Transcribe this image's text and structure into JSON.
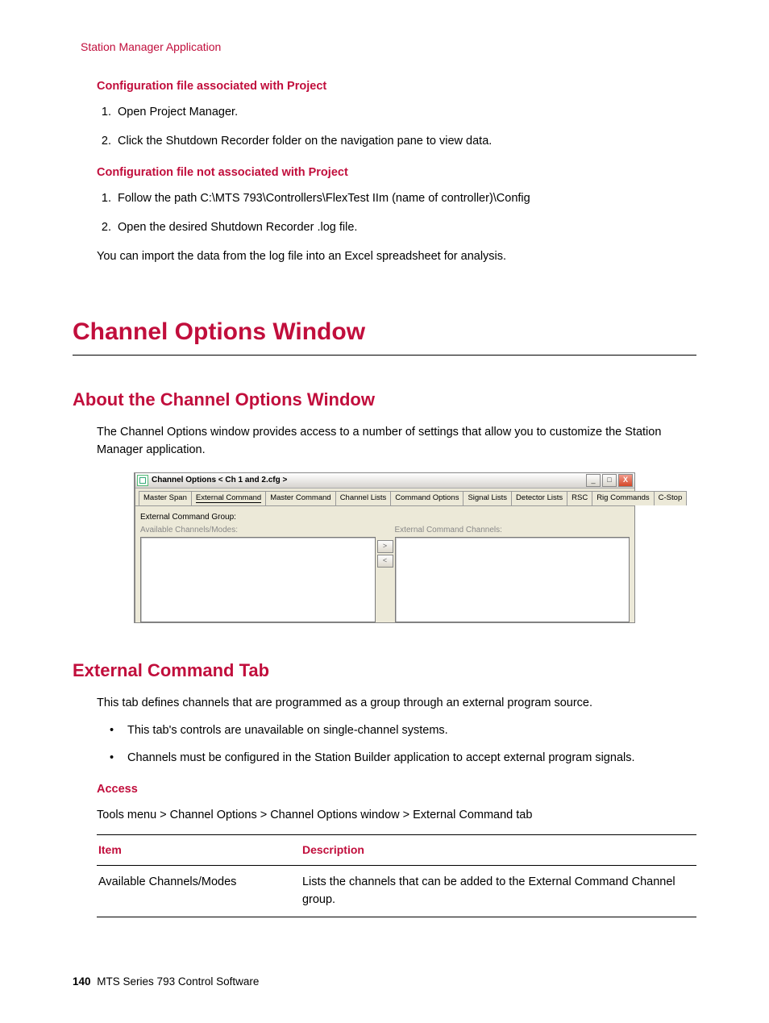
{
  "running_head": "Station Manager Application",
  "section_a": {
    "title": "Configuration file associated with Project",
    "steps": [
      "Open Project Manager.",
      "Click the Shutdown Recorder folder on the navigation pane to view data."
    ]
  },
  "section_b": {
    "title": "Configuration file not associated with Project",
    "steps": [
      "Follow the path C:\\MTS 793\\Controllers\\FlexTest IIm (name of controller)\\Config",
      "Open the desired Shutdown Recorder .log file."
    ]
  },
  "post_para": "You can import the data from the log file into an Excel spreadsheet for analysis.",
  "h1": "Channel Options Window",
  "h2_about": "About the Channel Options Window",
  "about_para": "The Channel Options window provides access to a number of settings that allow you to customize the Station Manager application.",
  "screenshot": {
    "title": "Channel Options < Ch 1 and 2.cfg >",
    "tabs": [
      "Master Span",
      "External Command",
      "Master Command",
      "Channel Lists",
      "Command Options",
      "Signal Lists",
      "Detector Lists",
      "RSC",
      "Rig Commands",
      "C-Stop"
    ],
    "active_tab_index": 1,
    "group_label": "External Command Group:",
    "left_label": "Available Channels/Modes:",
    "right_label": "External Command Channels:",
    "btn_min": "_",
    "btn_max": "□",
    "btn_close": "X",
    "arrow_r": ">",
    "arrow_l": "<"
  },
  "h2_ext": "External Command Tab",
  "ext_para": "This tab defines channels that are programmed as a group through an external program source.",
  "ext_bullets": [
    "This tab's controls are unavailable on single-channel systems.",
    "Channels must be configured in the Station Builder application to accept external program signals."
  ],
  "access_title": "Access",
  "access_path": "Tools menu > Channel Options > Channel Options window > External Command tab",
  "table": {
    "h1": "Item",
    "h2": "Description",
    "rows": [
      {
        "item": "Available Channels/Modes",
        "desc": "Lists the channels that can be added to the External Command Channel group."
      }
    ]
  },
  "footer": {
    "page": "140",
    "text": "MTS Series 793 Control Software"
  }
}
